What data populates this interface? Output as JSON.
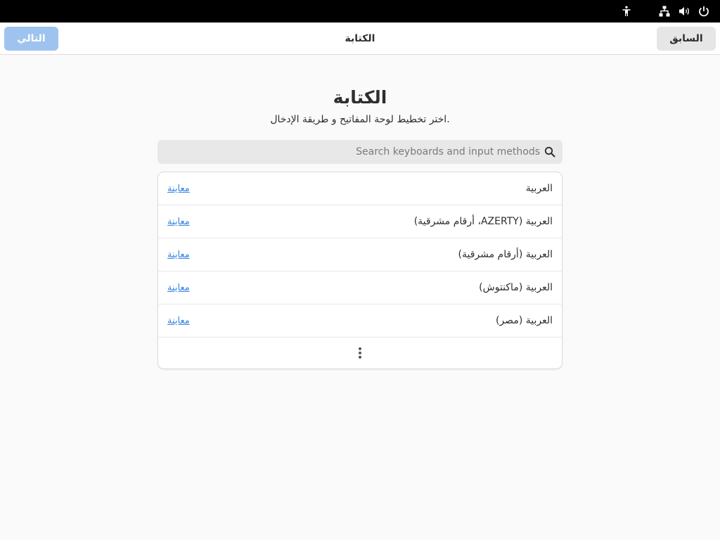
{
  "topbar": {
    "icons": [
      "accessibility-icon",
      "network-icon",
      "volume-icon",
      "power-icon"
    ]
  },
  "header": {
    "back_label": "السابق",
    "next_label": "التالي",
    "title": "الكتابة"
  },
  "main": {
    "title": "الكتابة",
    "subtitle": "اختر تخطيط لوحة المفاتيح و طريقة الإدخال.",
    "search": {
      "placeholder": "Search keyboards and input methods",
      "value": ""
    },
    "layouts": [
      {
        "name": "العربية",
        "preview": "معاينة"
      },
      {
        "name": "العربية  (AZERTY، أرقام مشرقية)",
        "preview": "معاينة"
      },
      {
        "name": "العربية (أرقام مشرقية)",
        "preview": "معاينة"
      },
      {
        "name": "العربية (ماكنتوش)",
        "preview": "معاينة"
      },
      {
        "name": "العربية (مصر)",
        "preview": "معاينة"
      }
    ]
  },
  "colors": {
    "accent": "#3584e4",
    "next_button_disabled": "#9ec3ee",
    "topbar": "#000000"
  }
}
